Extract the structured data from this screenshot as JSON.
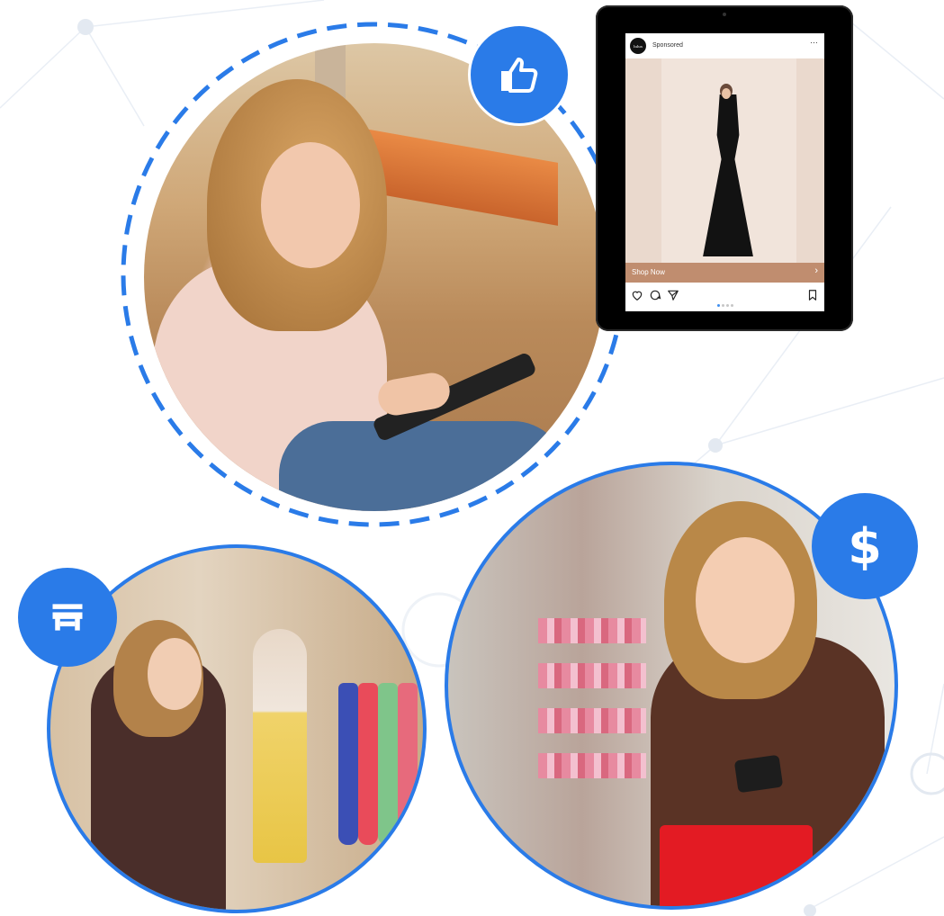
{
  "ad": {
    "account_label": "lulus",
    "sponsored": "Sponsored",
    "more": "…",
    "cta_label": "Shop Now",
    "cta_chevron": "›",
    "carousel_total": 4,
    "carousel_active": 1
  },
  "icons": {
    "like": "thumbs-up-icon",
    "dollar_symbol": "$",
    "store": "storefront-icon"
  },
  "colors": {
    "accent": "#2a7be8",
    "cta_band": "#c08d6f"
  }
}
